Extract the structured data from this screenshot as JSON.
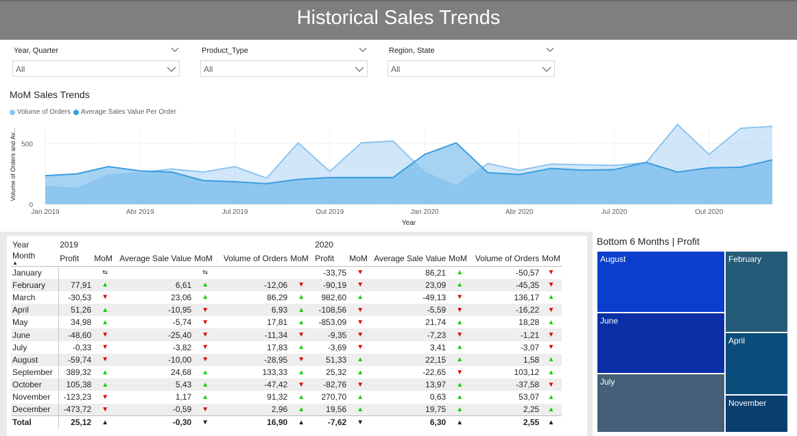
{
  "header": {
    "title": "Historical Sales Trends"
  },
  "slicers": [
    {
      "label": "Year, Quarter",
      "value": "All"
    },
    {
      "label": "Product_Type",
      "value": "All"
    },
    {
      "label": "Region, State",
      "value": "All"
    }
  ],
  "chart": {
    "title": "MoM Sales Trends",
    "legend": [
      "Volume of Orders",
      "Average Sales Value Per Order"
    ],
    "colors": {
      "volume": "#8cc4f0",
      "average": "#3a9de0"
    }
  },
  "chart_data": {
    "type": "area",
    "xlabel": "Year",
    "ylabel": "Volume of Orders and Av...",
    "ylim": [
      0,
      800
    ],
    "yticks": [
      0,
      500
    ],
    "xtick_labels": [
      "Jan 2019",
      "Abr 2019",
      "Jul 2019",
      "Out 2019",
      "Jan 2020",
      "Abr 2020",
      "Jul 2020",
      "Out 2020"
    ],
    "x": [
      "Jan 2019",
      "Fev 2019",
      "Mar 2019",
      "Abr 2019",
      "Mai 2019",
      "Jun 2019",
      "Jul 2019",
      "Ago 2019",
      "Set 2019",
      "Out 2019",
      "Nov 2019",
      "Dez 2019",
      "Jan 2020",
      "Fev 2020",
      "Mar 2020",
      "Abr 2020",
      "Mai 2020",
      "Jun 2020",
      "Jul 2020",
      "Ago 2020",
      "Set 2020",
      "Out 2020",
      "Nov 2020",
      "Dez 2020"
    ],
    "series": [
      {
        "name": "Volume of Orders",
        "values": [
          145,
          130,
          240,
          260,
          290,
          265,
          310,
          215,
          505,
          270,
          505,
          520,
          265,
          150,
          335,
          280,
          330,
          325,
          320,
          340,
          655,
          410,
          625,
          640
        ]
      },
      {
        "name": "Average Sales Value Per Order",
        "values": [
          235,
          250,
          310,
          275,
          265,
          195,
          185,
          170,
          205,
          220,
          220,
          220,
          410,
          505,
          260,
          245,
          295,
          280,
          285,
          345,
          265,
          300,
          305,
          365
        ]
      }
    ]
  },
  "table": {
    "year_label": "Year",
    "month_label": "Month",
    "years": [
      "2019",
      "2020"
    ],
    "columns": [
      "Profit",
      "MoM",
      "Average Sale Value",
      "MoM",
      "Volume of Orders",
      "MoM"
    ],
    "rows": [
      {
        "month": "January",
        "c": [
          "",
          "⇆",
          "",
          "⇆",
          "",
          "",
          "-33,75",
          "▼",
          "86,21",
          "▲",
          "-50,57",
          "▼"
        ]
      },
      {
        "month": "February",
        "c": [
          "77,91",
          "▲",
          "6,61",
          "▲",
          "-12,06",
          "▼",
          "-90,19",
          "▼",
          "23,09",
          "▲",
          "-45,35",
          "▼"
        ]
      },
      {
        "month": "March",
        "c": [
          "-30,53",
          "▼",
          "23,06",
          "▲",
          "86,29",
          "▲",
          "982,60",
          "▲",
          "-49,13",
          "▼",
          "136,17",
          "▲"
        ]
      },
      {
        "month": "April",
        "c": [
          "51,26",
          "▲",
          "-10,95",
          "▼",
          "6,93",
          "▲",
          "-108,56",
          "▼",
          "-5,59",
          "▼",
          "-16,22",
          "▼"
        ]
      },
      {
        "month": "May",
        "c": [
          "34,98",
          "▲",
          "-5,74",
          "▼",
          "17,81",
          "▲",
          "-853,09",
          "▼",
          "21,74",
          "▲",
          "18,28",
          "▲"
        ]
      },
      {
        "month": "June",
        "c": [
          "-48,60",
          "▼",
          "-25,40",
          "▼",
          "-11,34",
          "▼",
          "-9,35",
          "▼",
          "-7,23",
          "▼",
          "-1,21",
          "▼"
        ]
      },
      {
        "month": "July",
        "c": [
          "-0,33",
          "▼",
          "-3,82",
          "▼",
          "17,83",
          "▲",
          "-3,69",
          "▼",
          "3,41",
          "▲",
          "-3,07",
          "▼"
        ]
      },
      {
        "month": "August",
        "c": [
          "-59,74",
          "▼",
          "-10,00",
          "▼",
          "-28,95",
          "▼",
          "51,33",
          "▲",
          "22,15",
          "▲",
          "1,58",
          "▲"
        ]
      },
      {
        "month": "September",
        "c": [
          "389,32",
          "▲",
          "24,68",
          "▲",
          "133,33",
          "▲",
          "25,32",
          "▲",
          "-22,65",
          "▼",
          "103,12",
          "▲"
        ]
      },
      {
        "month": "October",
        "c": [
          "105,38",
          "▲",
          "5,43",
          "▲",
          "-47,42",
          "▼",
          "-82,76",
          "▼",
          "13,97",
          "▲",
          "-37,58",
          "▼"
        ]
      },
      {
        "month": "November",
        "c": [
          "-123,23",
          "▼",
          "1,17",
          "▲",
          "91,32",
          "▲",
          "270,70",
          "▲",
          "0,63",
          "▲",
          "53,07",
          "▲"
        ]
      },
      {
        "month": "December",
        "c": [
          "-473,72",
          "▼",
          "-0,59",
          "▼",
          "2,96",
          "▲",
          "19,56",
          "▲",
          "19,75",
          "▲",
          "2,25",
          "▲"
        ]
      }
    ],
    "total": {
      "month": "Total",
      "c": [
        "25,12",
        "▲",
        "-0,30",
        "▼",
        "16,90",
        "▲",
        "-7,62",
        "▼",
        "6,30",
        "▲",
        "2,55",
        "▲"
      ]
    }
  },
  "treemap": {
    "title": "Bottom 6 Months | Profit",
    "tiles": [
      {
        "label": "August",
        "color": "#0a3fce"
      },
      {
        "label": "June",
        "color": "#0a2fa6"
      },
      {
        "label": "July",
        "color": "#456078"
      },
      {
        "label": "February",
        "color": "#255a78"
      },
      {
        "label": "April",
        "color": "#0a4c7a"
      },
      {
        "label": "November",
        "color": "#0a3f6e"
      }
    ]
  },
  "colors": {
    "up": "#0fd100",
    "down": "#e00000",
    "header_bg": "#7f7f7f"
  }
}
